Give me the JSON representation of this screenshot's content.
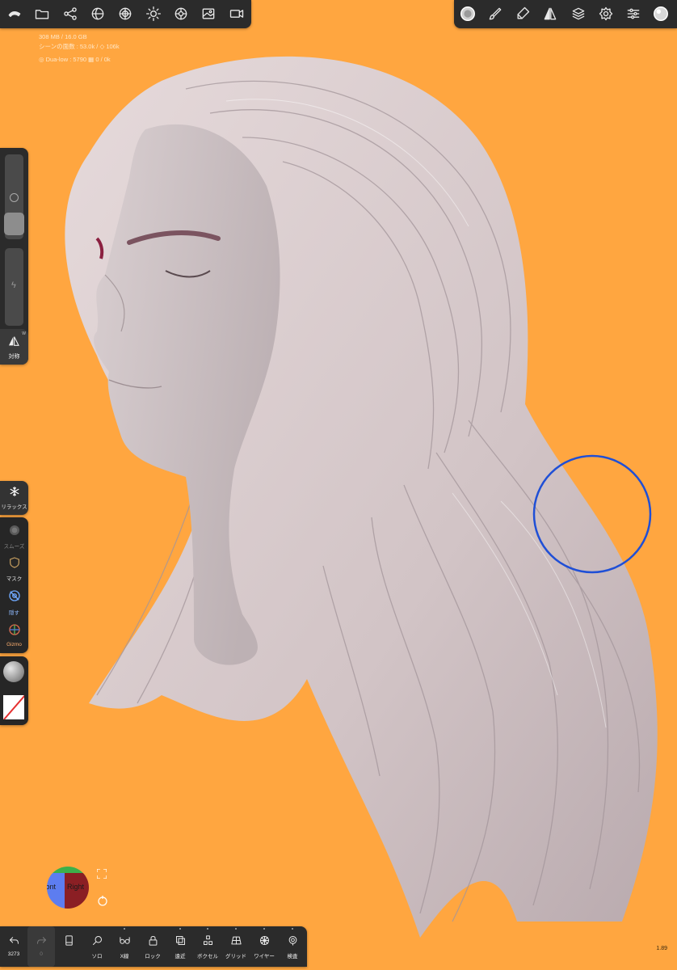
{
  "top_left_toolbar": {
    "items": [
      {
        "name": "nomad-logo-icon"
      },
      {
        "name": "folder-icon"
      },
      {
        "name": "scene-graph-icon"
      },
      {
        "name": "shading-icon"
      },
      {
        "name": "material-icon"
      },
      {
        "name": "light-icon"
      },
      {
        "name": "post-process-icon"
      },
      {
        "name": "background-image-icon"
      },
      {
        "name": "camera-icon"
      }
    ]
  },
  "top_right_toolbar": {
    "items": [
      {
        "name": "brush-alpha-icon"
      },
      {
        "name": "paint-brush-icon"
      },
      {
        "name": "stroke-icon"
      },
      {
        "name": "symmetry-icon"
      },
      {
        "name": "layers-icon"
      },
      {
        "name": "settings-icon"
      },
      {
        "name": "sliders-icon"
      },
      {
        "name": "matcap-preview-icon"
      }
    ]
  },
  "stats": {
    "memory": "308 MB / 16.0 GB",
    "scene": "シーンの面数 : 53.0k / ◇ 106k",
    "mesh": "◎ Dua-low : 5790 ▦ 0 / 0k"
  },
  "left_panel": {
    "symmetry_label": "対称",
    "symmetry_badge": "W"
  },
  "tools": {
    "relax": "リラックス",
    "smooth": "スムーズ",
    "mask": "マスク",
    "hide": "隠す",
    "gizmo": "Gizmo"
  },
  "viewport": {
    "cube_left": "Front",
    "cube_right": "Right",
    "brush_color": "#1f4fd6"
  },
  "bottom_bar": {
    "undo_count": "3273",
    "items": [
      {
        "icon": "undo-icon",
        "label": "3273"
      },
      {
        "icon": "redo-icon",
        "label": "0"
      },
      {
        "icon": "phone-icon",
        "label": ""
      },
      {
        "icon": "magnifier-icon",
        "label": "ソロ"
      },
      {
        "icon": "xray-glasses-icon",
        "label": "X線"
      },
      {
        "icon": "lock-icon",
        "label": "ロック"
      },
      {
        "icon": "perspective-icon",
        "label": "遠近"
      },
      {
        "icon": "voxel-icon",
        "label": "ボクセル"
      },
      {
        "icon": "grid-icon",
        "label": "グリッド"
      },
      {
        "icon": "wireframe-icon",
        "label": "ワイヤー"
      },
      {
        "icon": "inspect-icon",
        "label": "検査"
      }
    ]
  },
  "ratio": "1.89"
}
